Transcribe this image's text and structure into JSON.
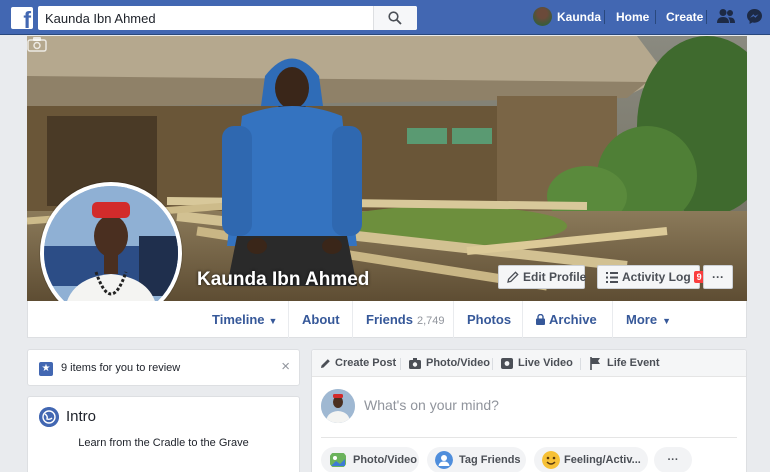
{
  "topbar": {
    "search_value": "Kaunda Ibn Ahmed",
    "logo": "f",
    "profile_name": "Kaunda",
    "home": "Home",
    "create": "Create",
    "icons": [
      "friend-requests-icon",
      "messenger-icon"
    ]
  },
  "cover": {
    "name": "Kaunda Ibn Ahmed",
    "edit_profile": "Edit Profile",
    "activity_log": "Activity Log",
    "activity_badge": "9",
    "more": "···"
  },
  "profile_nav": {
    "timeline": "Timeline",
    "about": "About",
    "friends": "Friends",
    "friends_count": "2,749",
    "photos": "Photos",
    "archive": "Archive",
    "more": "More"
  },
  "review": {
    "text": "9 items for you to review",
    "close": "×"
  },
  "intro": {
    "title": "Intro",
    "bio": "Learn from the Cradle to the Grave"
  },
  "composer": {
    "tabs": [
      "Create Post",
      "Photo/Video",
      "Live Video",
      "Life Event"
    ],
    "placeholder": "What's on your mind?",
    "actions": [
      "Photo/Video",
      "Tag Friends",
      "Feeling/Activ...",
      "···"
    ]
  },
  "colors": {
    "brand": "#4267b2",
    "link": "#365899",
    "background": "#e9ebee"
  }
}
